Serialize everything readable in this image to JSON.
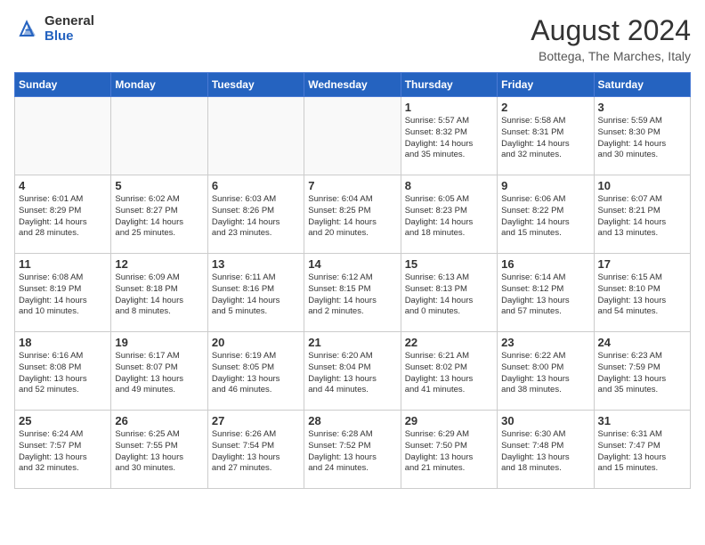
{
  "logo": {
    "general": "General",
    "blue": "Blue"
  },
  "title": "August 2024",
  "location": "Bottega, The Marches, Italy",
  "days_header": [
    "Sunday",
    "Monday",
    "Tuesday",
    "Wednesday",
    "Thursday",
    "Friday",
    "Saturday"
  ],
  "weeks": [
    [
      {
        "day": "",
        "info": ""
      },
      {
        "day": "",
        "info": ""
      },
      {
        "day": "",
        "info": ""
      },
      {
        "day": "",
        "info": ""
      },
      {
        "day": "1",
        "info": "Sunrise: 5:57 AM\nSunset: 8:32 PM\nDaylight: 14 hours\nand 35 minutes."
      },
      {
        "day": "2",
        "info": "Sunrise: 5:58 AM\nSunset: 8:31 PM\nDaylight: 14 hours\nand 32 minutes."
      },
      {
        "day": "3",
        "info": "Sunrise: 5:59 AM\nSunset: 8:30 PM\nDaylight: 14 hours\nand 30 minutes."
      }
    ],
    [
      {
        "day": "4",
        "info": "Sunrise: 6:01 AM\nSunset: 8:29 PM\nDaylight: 14 hours\nand 28 minutes."
      },
      {
        "day": "5",
        "info": "Sunrise: 6:02 AM\nSunset: 8:27 PM\nDaylight: 14 hours\nand 25 minutes."
      },
      {
        "day": "6",
        "info": "Sunrise: 6:03 AM\nSunset: 8:26 PM\nDaylight: 14 hours\nand 23 minutes."
      },
      {
        "day": "7",
        "info": "Sunrise: 6:04 AM\nSunset: 8:25 PM\nDaylight: 14 hours\nand 20 minutes."
      },
      {
        "day": "8",
        "info": "Sunrise: 6:05 AM\nSunset: 8:23 PM\nDaylight: 14 hours\nand 18 minutes."
      },
      {
        "day": "9",
        "info": "Sunrise: 6:06 AM\nSunset: 8:22 PM\nDaylight: 14 hours\nand 15 minutes."
      },
      {
        "day": "10",
        "info": "Sunrise: 6:07 AM\nSunset: 8:21 PM\nDaylight: 14 hours\nand 13 minutes."
      }
    ],
    [
      {
        "day": "11",
        "info": "Sunrise: 6:08 AM\nSunset: 8:19 PM\nDaylight: 14 hours\nand 10 minutes."
      },
      {
        "day": "12",
        "info": "Sunrise: 6:09 AM\nSunset: 8:18 PM\nDaylight: 14 hours\nand 8 minutes."
      },
      {
        "day": "13",
        "info": "Sunrise: 6:11 AM\nSunset: 8:16 PM\nDaylight: 14 hours\nand 5 minutes."
      },
      {
        "day": "14",
        "info": "Sunrise: 6:12 AM\nSunset: 8:15 PM\nDaylight: 14 hours\nand 2 minutes."
      },
      {
        "day": "15",
        "info": "Sunrise: 6:13 AM\nSunset: 8:13 PM\nDaylight: 14 hours\nand 0 minutes."
      },
      {
        "day": "16",
        "info": "Sunrise: 6:14 AM\nSunset: 8:12 PM\nDaylight: 13 hours\nand 57 minutes."
      },
      {
        "day": "17",
        "info": "Sunrise: 6:15 AM\nSunset: 8:10 PM\nDaylight: 13 hours\nand 54 minutes."
      }
    ],
    [
      {
        "day": "18",
        "info": "Sunrise: 6:16 AM\nSunset: 8:08 PM\nDaylight: 13 hours\nand 52 minutes."
      },
      {
        "day": "19",
        "info": "Sunrise: 6:17 AM\nSunset: 8:07 PM\nDaylight: 13 hours\nand 49 minutes."
      },
      {
        "day": "20",
        "info": "Sunrise: 6:19 AM\nSunset: 8:05 PM\nDaylight: 13 hours\nand 46 minutes."
      },
      {
        "day": "21",
        "info": "Sunrise: 6:20 AM\nSunset: 8:04 PM\nDaylight: 13 hours\nand 44 minutes."
      },
      {
        "day": "22",
        "info": "Sunrise: 6:21 AM\nSunset: 8:02 PM\nDaylight: 13 hours\nand 41 minutes."
      },
      {
        "day": "23",
        "info": "Sunrise: 6:22 AM\nSunset: 8:00 PM\nDaylight: 13 hours\nand 38 minutes."
      },
      {
        "day": "24",
        "info": "Sunrise: 6:23 AM\nSunset: 7:59 PM\nDaylight: 13 hours\nand 35 minutes."
      }
    ],
    [
      {
        "day": "25",
        "info": "Sunrise: 6:24 AM\nSunset: 7:57 PM\nDaylight: 13 hours\nand 32 minutes."
      },
      {
        "day": "26",
        "info": "Sunrise: 6:25 AM\nSunset: 7:55 PM\nDaylight: 13 hours\nand 30 minutes."
      },
      {
        "day": "27",
        "info": "Sunrise: 6:26 AM\nSunset: 7:54 PM\nDaylight: 13 hours\nand 27 minutes."
      },
      {
        "day": "28",
        "info": "Sunrise: 6:28 AM\nSunset: 7:52 PM\nDaylight: 13 hours\nand 24 minutes."
      },
      {
        "day": "29",
        "info": "Sunrise: 6:29 AM\nSunset: 7:50 PM\nDaylight: 13 hours\nand 21 minutes."
      },
      {
        "day": "30",
        "info": "Sunrise: 6:30 AM\nSunset: 7:48 PM\nDaylight: 13 hours\nand 18 minutes."
      },
      {
        "day": "31",
        "info": "Sunrise: 6:31 AM\nSunset: 7:47 PM\nDaylight: 13 hours\nand 15 minutes."
      }
    ]
  ]
}
